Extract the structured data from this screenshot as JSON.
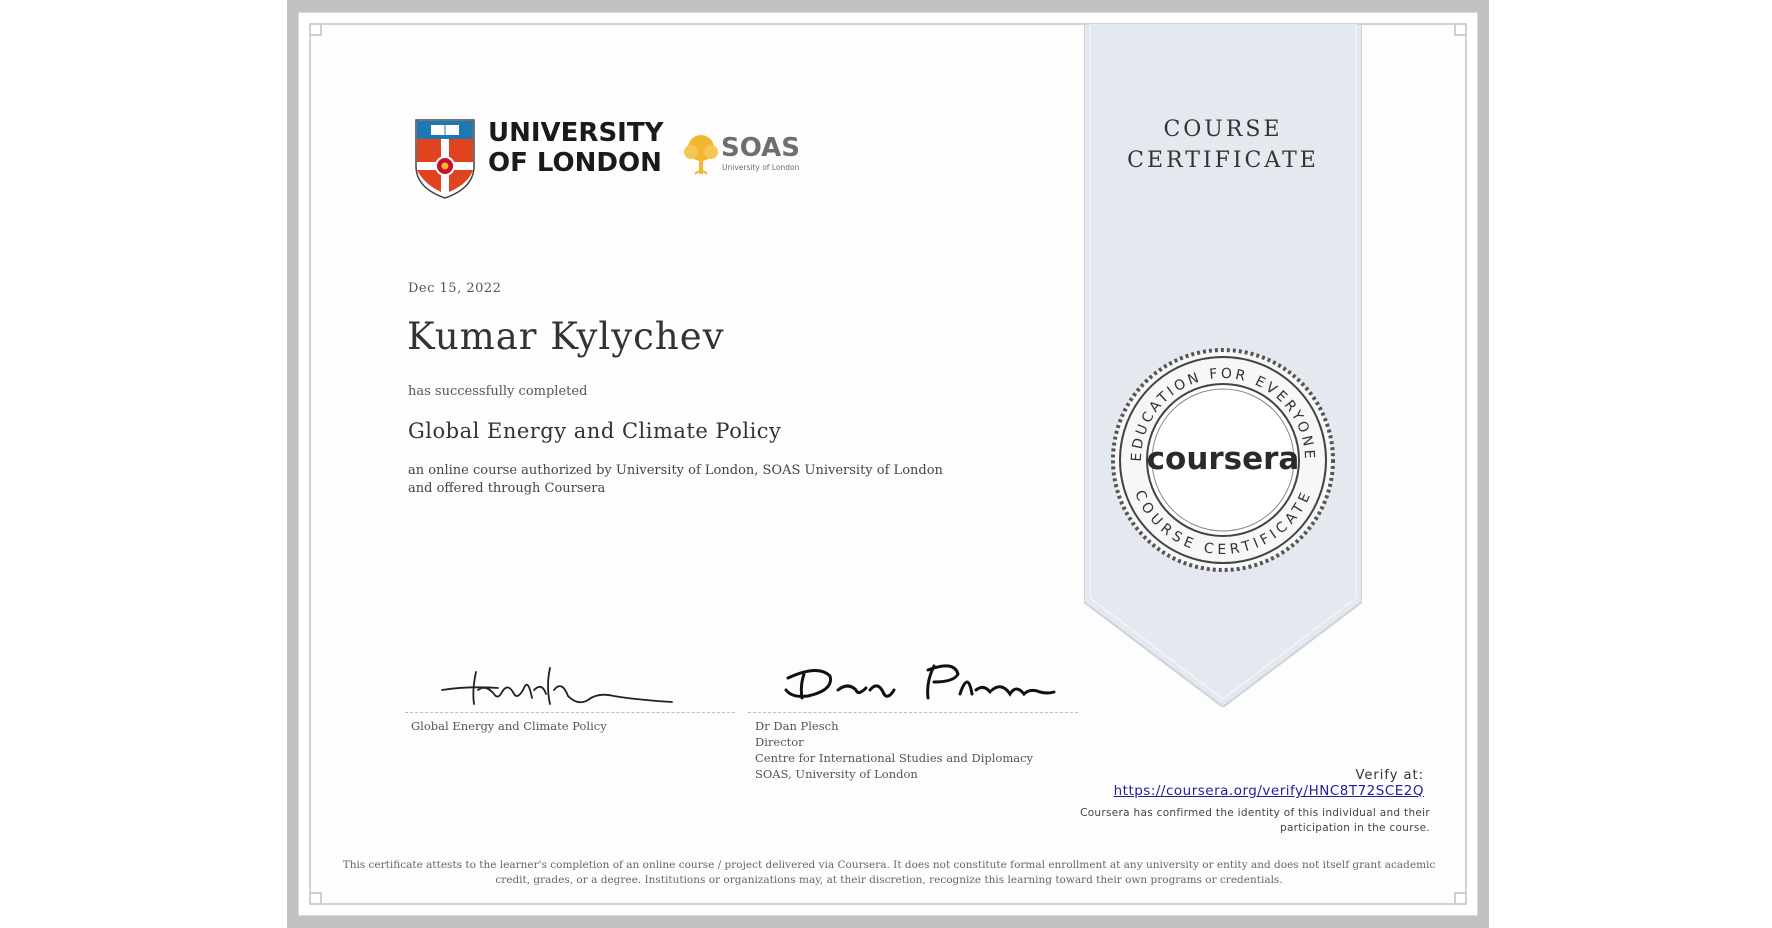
{
  "certificate": {
    "date": "Dec 15, 2022",
    "recipient_name": "Kumar Kylychev",
    "completed_text": "has successfully completed",
    "course_name": "Global Energy and Climate Policy",
    "description": "an online course authorized by University of London, SOAS University of London and offered through Coursera",
    "ribbon_line1": "COURSE",
    "ribbon_line2": "CERTIFICATE"
  },
  "logos": {
    "uol_line1": "UNIVERSITY",
    "uol_line2": "OF LONDON",
    "soas_name": "SOAS",
    "soas_sub": "University of London"
  },
  "seal": {
    "brand": "coursera",
    "top_text": "EDUCATION FOR EVERYONE",
    "bottom_text": "COURSE CERTIFICATE"
  },
  "signatures": [
    {
      "lines": [
        "Global Energy and Climate Policy"
      ]
    },
    {
      "lines": [
        "Dr Dan Plesch",
        "Director",
        "Centre for International Studies and Diplomacy",
        "SOAS, University of London"
      ]
    }
  ],
  "verification": {
    "label": "Verify at:",
    "url": "https://coursera.org/verify/HNC8T72SCE2Q",
    "note": "Coursera has confirmed the identity of this individual and their participation in the course."
  },
  "disclaimer": "This certificate attests to the learner's completion of an online course / project delivered via Coursera. It does not constitute formal enrollment at any university or entity and does not itself grant academic credit, grades, or a degree. Institutions or organizations may, at their discretion, recognize this learning toward their own programs or credentials.",
  "colors": {
    "frame": "#c2c2c2",
    "ribbon": "#e4e8ef",
    "link": "#1f1f9e",
    "uol_red": "#e0431d",
    "uol_blue": "#1e78b4",
    "soas_gold": "#f2b730"
  }
}
